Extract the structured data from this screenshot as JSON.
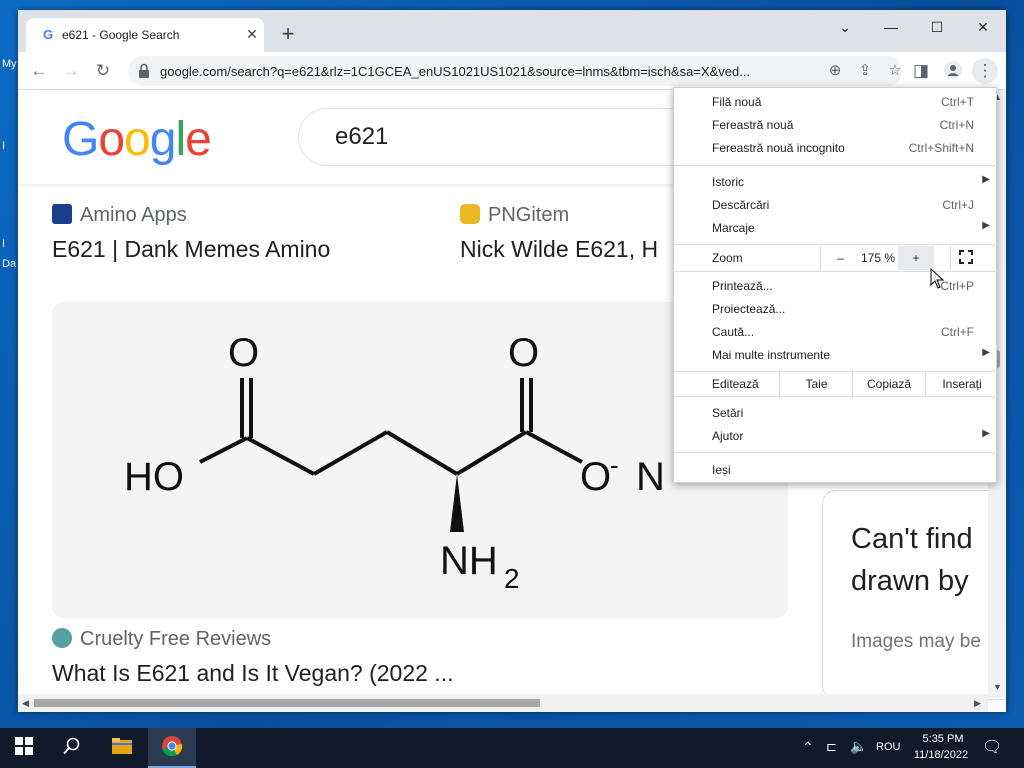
{
  "desktop": {
    "labels": [
      "My",
      "I",
      "I",
      "Da"
    ]
  },
  "browser": {
    "tab_title": "e621 - Google Search",
    "tab_favicon": "G",
    "new_tab_icon": "+",
    "url": "google.com/search?q=e621&rlz=1C1GCEA_enUS1021US1021&source=lnms&tbm=isch&sa=X&ved...",
    "window_controls": {
      "dropdown": "⌄",
      "minimize": "—",
      "maximize": "☐",
      "close": "✕"
    }
  },
  "page": {
    "logo_letters": [
      {
        "ch": "G",
        "color": "#4285f4"
      },
      {
        "ch": "o",
        "color": "#ea4335"
      },
      {
        "ch": "o",
        "color": "#fbbc05"
      },
      {
        "ch": "g",
        "color": "#4285f4"
      },
      {
        "ch": "l",
        "color": "#34a853"
      },
      {
        "ch": "e",
        "color": "#ea4335"
      }
    ],
    "search_query": "e621",
    "results": [
      {
        "source": "Amino Apps",
        "title": "E621 | Dank Memes Amino"
      },
      {
        "source": "PNGitem",
        "title": "Nick Wilde E621, H"
      },
      {
        "source": "Cruelty Free Reviews",
        "title": "What Is E621 and Is It Vegan? (2022 ..."
      }
    ],
    "molecule_labels": {
      "o1": "O",
      "o2": "O",
      "ho": "HO",
      "o3": "O",
      "minus": "-",
      "n": "N",
      "nh": "NH",
      "sub2": "2"
    },
    "side_card": {
      "line1": "Can't find",
      "line2": "drawn by",
      "line3": "Images may be"
    }
  },
  "menu": {
    "items_top": [
      {
        "label": "Filă nouă",
        "shortcut": "Ctrl+T"
      },
      {
        "label": "Fereastră nouă",
        "shortcut": "Ctrl+N"
      },
      {
        "label": "Fereastră nouă incognito",
        "shortcut": "Ctrl+Shift+N"
      }
    ],
    "items_history": [
      {
        "label": "Istoric",
        "shortcut": "",
        "submenu": true
      },
      {
        "label": "Descărcări",
        "shortcut": "Ctrl+J",
        "submenu": false
      },
      {
        "label": "Marcaje",
        "shortcut": "",
        "submenu": true
      }
    ],
    "zoom": {
      "label": "Zoom",
      "minus": "–",
      "value": "175 %",
      "plus": "+"
    },
    "items_tools": [
      {
        "label": "Printează...",
        "shortcut": "Ctrl+P",
        "submenu": false
      },
      {
        "label": "Proiectează...",
        "shortcut": "",
        "submenu": false
      },
      {
        "label": "Caută...",
        "shortcut": "Ctrl+F",
        "submenu": false
      },
      {
        "label": "Mai multe instrumente",
        "shortcut": "",
        "submenu": true
      }
    ],
    "edit": {
      "label": "Editează",
      "cut": "Taie",
      "copy": "Copiază",
      "paste": "Inserați"
    },
    "items_settings": [
      {
        "label": "Setări",
        "submenu": false
      },
      {
        "label": "Ajutor",
        "submenu": true
      }
    ],
    "exit": "Ieși"
  },
  "taskbar": {
    "language": "ROU",
    "time": "5:35 PM",
    "date": "11/18/2022"
  }
}
